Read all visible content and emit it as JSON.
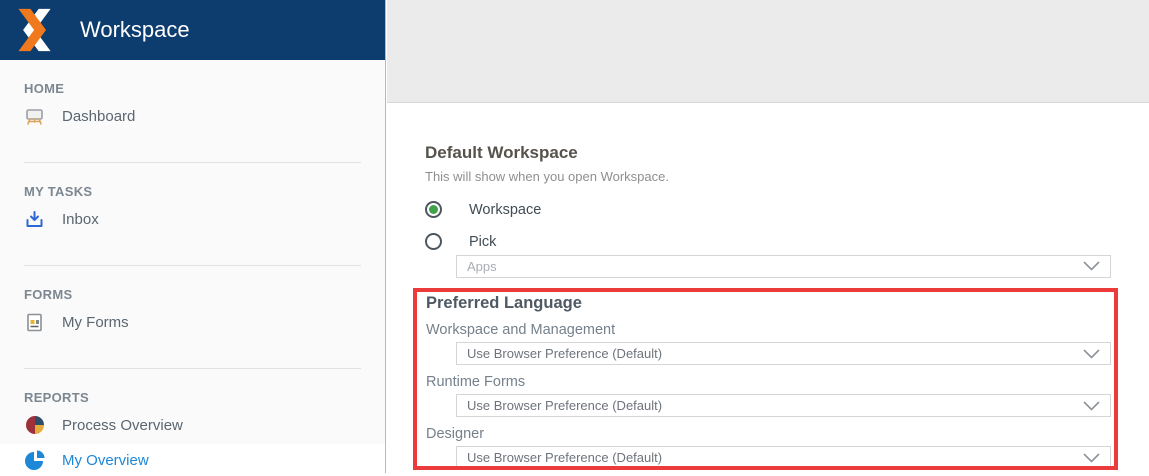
{
  "app": {
    "title": "Workspace"
  },
  "sidebar": {
    "sections": [
      {
        "label": "HOME",
        "items": [
          {
            "label": "Dashboard",
            "icon": "easel-dashboard-icon",
            "active": false
          }
        ]
      },
      {
        "label": "MY TASKS",
        "items": [
          {
            "label": "Inbox",
            "icon": "inbox-download-icon",
            "active": false
          }
        ]
      },
      {
        "label": "FORMS",
        "items": [
          {
            "label": "My Forms",
            "icon": "form-document-icon",
            "active": false
          }
        ]
      },
      {
        "label": "REPORTS",
        "items": [
          {
            "label": "Process Overview",
            "icon": "pie-chart-multicolor-icon",
            "active": false
          },
          {
            "label": "My Overview",
            "icon": "pie-chart-blue-icon",
            "active": true
          }
        ]
      }
    ]
  },
  "main": {
    "default_workspace": {
      "title": "Default Workspace",
      "description": "This will show when you open Workspace.",
      "options": [
        {
          "label": "Workspace",
          "selected": true
        },
        {
          "label": "Pick",
          "selected": false
        }
      ],
      "pick_dropdown": {
        "placeholder": "Apps"
      }
    },
    "preferred_language": {
      "title": "Preferred Language",
      "highlighted": true,
      "fields": [
        {
          "label": "Workspace and Management",
          "value": "Use Browser Preference (Default)"
        },
        {
          "label": "Runtime Forms",
          "value": "Use Browser Preference (Default)"
        },
        {
          "label": "Designer",
          "value": "Use Browser Preference (Default)"
        }
      ]
    }
  },
  "colors": {
    "header_navy": "#0d3c6e",
    "logo_orange": "#f1791d",
    "highlight_red": "#ec3b3b",
    "radio_selected_green": "#3fa34d",
    "active_item_blue": "#1d87d8"
  }
}
